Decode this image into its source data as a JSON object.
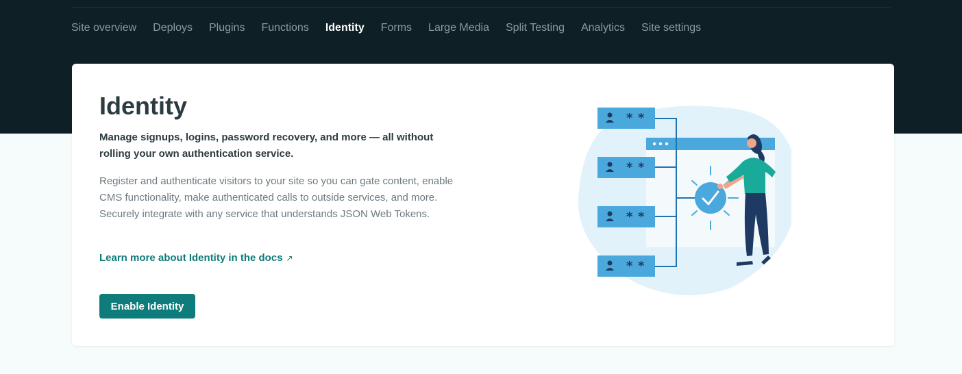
{
  "nav": {
    "items": [
      {
        "label": "Site overview"
      },
      {
        "label": "Deploys"
      },
      {
        "label": "Plugins"
      },
      {
        "label": "Functions"
      },
      {
        "label": "Identity",
        "active": true
      },
      {
        "label": "Forms"
      },
      {
        "label": "Large Media"
      },
      {
        "label": "Split Testing"
      },
      {
        "label": "Analytics"
      },
      {
        "label": "Site settings"
      }
    ]
  },
  "card": {
    "title": "Identity",
    "lede": "Manage signups, logins, password recovery, and more — all without rolling your own authentication service.",
    "description": "Register and authenticate visitors to your site so you can gate content, enable CMS functionality, make authenticated calls to outside services, and more. Securely integrate with any service that understands JSON Web Tokens.",
    "docs_link": "Learn more about Identity in the docs",
    "docs_arrow": "↗",
    "button": "Enable Identity"
  },
  "colors": {
    "header_bg": "#0f1f26",
    "page_bg": "#f6fcfc",
    "accent": "#0e7c7b",
    "illustration_blue": "#4aa8dc"
  }
}
